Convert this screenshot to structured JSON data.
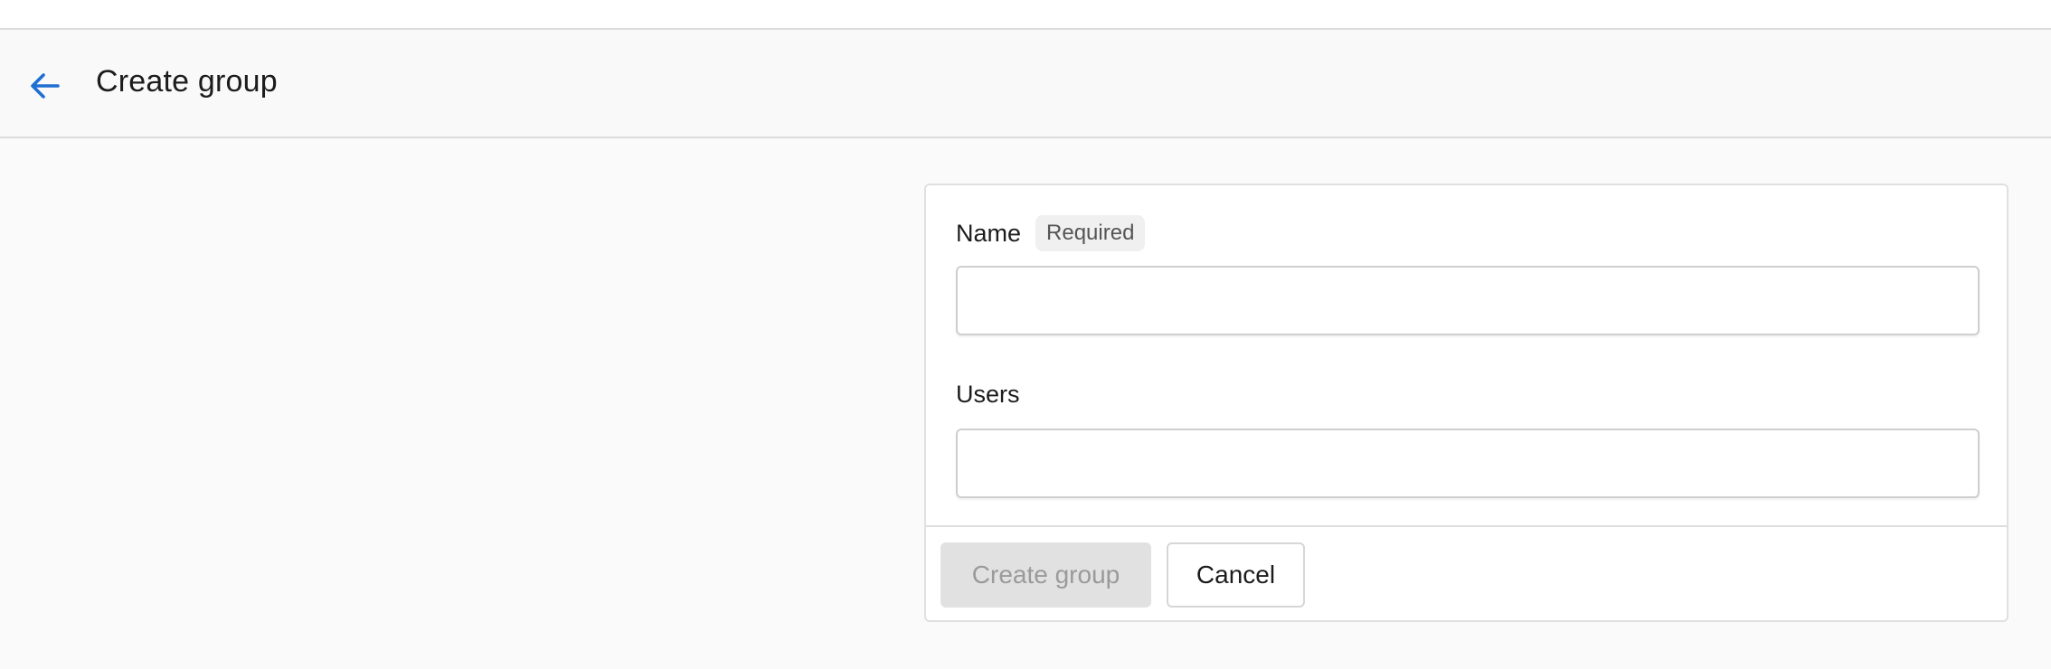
{
  "header": {
    "title": "Create group",
    "back_icon": "arrow-left-icon",
    "accent_color": "#1f6fd1"
  },
  "form": {
    "name": {
      "label": "Name",
      "required_badge": "Required",
      "value": "",
      "placeholder": ""
    },
    "users": {
      "label": "Users",
      "value": "",
      "placeholder": ""
    }
  },
  "actions": {
    "create_label": "Create group",
    "cancel_label": "Cancel"
  }
}
